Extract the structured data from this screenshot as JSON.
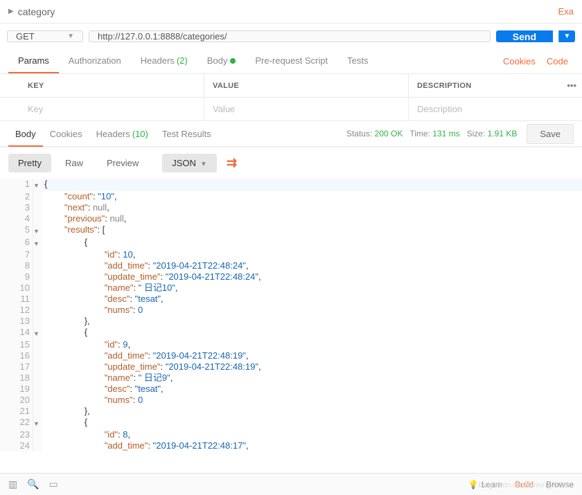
{
  "titlebar": {
    "title": "category",
    "right": "Exa"
  },
  "request": {
    "method": "GET",
    "url": "http://127.0.0.1:8888/categories/",
    "send_label": "Send"
  },
  "req_tabs": {
    "params": "Params",
    "auth": "Authorization",
    "headers": "Headers",
    "headers_count": "(2)",
    "body": "Body",
    "prereq": "Pre-request Script",
    "tests": "Tests",
    "cookies_link": "Cookies",
    "code_link": "Code"
  },
  "param_headers": {
    "key": "KEY",
    "value": "VALUE",
    "desc": "DESCRIPTION"
  },
  "param_placeholders": {
    "key": "Key",
    "value": "Value",
    "desc": "Description"
  },
  "resp_tabs": {
    "body": "Body",
    "cookies": "Cookies",
    "headers": "Headers",
    "headers_count": "(10)",
    "test_results": "Test Results"
  },
  "status": {
    "status_label": "Status:",
    "status_value": "200 OK",
    "time_label": "Time:",
    "time_value": "131 ms",
    "size_label": "Size:",
    "size_value": "1.91 KB",
    "save": "Save"
  },
  "view": {
    "pretty": "Pretty",
    "raw": "Raw",
    "preview": "Preview",
    "format": "JSON"
  },
  "response_body": {
    "count": "10",
    "next": null,
    "previous": null,
    "results": [
      {
        "id": 10,
        "add_time": "2019-04-21T22:48:24",
        "update_time": "2019-04-21T22:48:24",
        "name": " 日记10",
        "desc": "tesat",
        "nums": 0
      },
      {
        "id": 9,
        "add_time": "2019-04-21T22:48:19",
        "update_time": "2019-04-21T22:48:19",
        "name": " 日记9",
        "desc": "tesat",
        "nums": 0
      },
      {
        "id": 8,
        "add_time": "2019-04-21T22:48:17"
      }
    ]
  },
  "code_lines": [
    {
      "n": 1,
      "fold": true,
      "indent": 0,
      "raw": "{"
    },
    {
      "n": 2,
      "indent": 2,
      "parts": [
        [
          "key",
          "\"count\""
        ],
        [
          "punc",
          ": "
        ],
        [
          "str",
          "\"10\""
        ],
        [
          "punc",
          ","
        ]
      ]
    },
    {
      "n": 3,
      "indent": 2,
      "parts": [
        [
          "key",
          "\"next\""
        ],
        [
          "punc",
          ": "
        ],
        [
          "null",
          "null"
        ],
        [
          "punc",
          ","
        ]
      ]
    },
    {
      "n": 4,
      "indent": 2,
      "parts": [
        [
          "key",
          "\"previous\""
        ],
        [
          "punc",
          ": "
        ],
        [
          "null",
          "null"
        ],
        [
          "punc",
          ","
        ]
      ]
    },
    {
      "n": 5,
      "fold": true,
      "indent": 2,
      "parts": [
        [
          "key",
          "\"results\""
        ],
        [
          "punc",
          ": ["
        ]
      ]
    },
    {
      "n": 6,
      "fold": true,
      "indent": 4,
      "raw": "{"
    },
    {
      "n": 7,
      "indent": 6,
      "parts": [
        [
          "key",
          "\"id\""
        ],
        [
          "punc",
          ": "
        ],
        [
          "num",
          "10"
        ],
        [
          "punc",
          ","
        ]
      ]
    },
    {
      "n": 8,
      "indent": 6,
      "parts": [
        [
          "key",
          "\"add_time\""
        ],
        [
          "punc",
          ": "
        ],
        [
          "str",
          "\"2019-04-21T22:48:24\""
        ],
        [
          "punc",
          ","
        ]
      ]
    },
    {
      "n": 9,
      "indent": 6,
      "parts": [
        [
          "key",
          "\"update_time\""
        ],
        [
          "punc",
          ": "
        ],
        [
          "str",
          "\"2019-04-21T22:48:24\""
        ],
        [
          "punc",
          ","
        ]
      ]
    },
    {
      "n": 10,
      "indent": 6,
      "parts": [
        [
          "key",
          "\"name\""
        ],
        [
          "punc",
          ": "
        ],
        [
          "str",
          "\" 日记10\""
        ],
        [
          "punc",
          ","
        ]
      ]
    },
    {
      "n": 11,
      "indent": 6,
      "parts": [
        [
          "key",
          "\"desc\""
        ],
        [
          "punc",
          ": "
        ],
        [
          "str",
          "\"tesat\""
        ],
        [
          "punc",
          ","
        ]
      ]
    },
    {
      "n": 12,
      "indent": 6,
      "parts": [
        [
          "key",
          "\"nums\""
        ],
        [
          "punc",
          ": "
        ],
        [
          "num",
          "0"
        ]
      ]
    },
    {
      "n": 13,
      "indent": 4,
      "raw": "},"
    },
    {
      "n": 14,
      "fold": true,
      "indent": 4,
      "raw": "{"
    },
    {
      "n": 15,
      "indent": 6,
      "parts": [
        [
          "key",
          "\"id\""
        ],
        [
          "punc",
          ": "
        ],
        [
          "num",
          "9"
        ],
        [
          "punc",
          ","
        ]
      ]
    },
    {
      "n": 16,
      "indent": 6,
      "parts": [
        [
          "key",
          "\"add_time\""
        ],
        [
          "punc",
          ": "
        ],
        [
          "str",
          "\"2019-04-21T22:48:19\""
        ],
        [
          "punc",
          ","
        ]
      ]
    },
    {
      "n": 17,
      "indent": 6,
      "parts": [
        [
          "key",
          "\"update_time\""
        ],
        [
          "punc",
          ": "
        ],
        [
          "str",
          "\"2019-04-21T22:48:19\""
        ],
        [
          "punc",
          ","
        ]
      ]
    },
    {
      "n": 18,
      "indent": 6,
      "parts": [
        [
          "key",
          "\"name\""
        ],
        [
          "punc",
          ": "
        ],
        [
          "str",
          "\" 日记9\""
        ],
        [
          "punc",
          ","
        ]
      ]
    },
    {
      "n": 19,
      "indent": 6,
      "parts": [
        [
          "key",
          "\"desc\""
        ],
        [
          "punc",
          ": "
        ],
        [
          "str",
          "\"tesat\""
        ],
        [
          "punc",
          ","
        ]
      ]
    },
    {
      "n": 20,
      "indent": 6,
      "parts": [
        [
          "key",
          "\"nums\""
        ],
        [
          "punc",
          ": "
        ],
        [
          "num",
          "0"
        ]
      ]
    },
    {
      "n": 21,
      "indent": 4,
      "raw": "},"
    },
    {
      "n": 22,
      "fold": true,
      "indent": 4,
      "raw": "{"
    },
    {
      "n": 23,
      "indent": 6,
      "parts": [
        [
          "key",
          "\"id\""
        ],
        [
          "punc",
          ": "
        ],
        [
          "num",
          "8"
        ],
        [
          "punc",
          ","
        ]
      ]
    },
    {
      "n": 24,
      "indent": 6,
      "parts": [
        [
          "key",
          "\"add_time\""
        ],
        [
          "punc",
          ": "
        ],
        [
          "str",
          "\"2019-04-21T22:48:17\""
        ],
        [
          "punc",
          ","
        ]
      ]
    }
  ],
  "footer": {
    "learn": "Learn",
    "build": "Build",
    "browse": "Browse",
    "watermark": "blog.csdn.net/weixin_3061"
  }
}
